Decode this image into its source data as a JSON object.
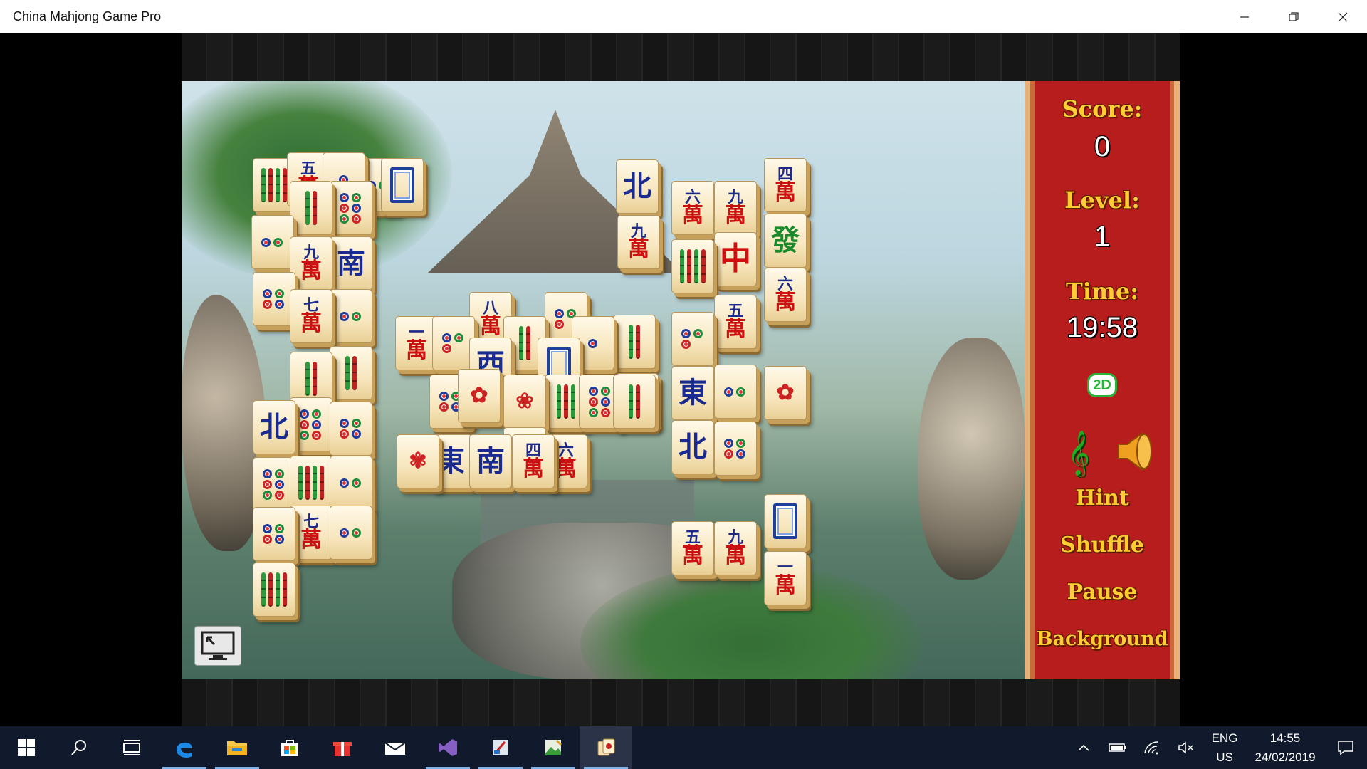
{
  "window": {
    "title": "China Mahjong Game Pro"
  },
  "panel": {
    "score_label": "Score:",
    "score_value": "0",
    "level_label": "Level:",
    "level_value": "1",
    "time_label": "Time:",
    "time_value": "19:58",
    "mode_badge": "2D",
    "hint": "Hint",
    "shuffle": "Shuffle",
    "pause": "Pause",
    "background": "Background"
  },
  "taskbar": {
    "apps": [
      "windows-start",
      "search",
      "task-view",
      "edge",
      "file-explorer",
      "store",
      "gift-app",
      "mail",
      "visual-studio",
      "paint-app",
      "photo-app",
      "mahjong-app"
    ],
    "lang_top": "ENG",
    "lang_bottom": "US",
    "time": "14:55",
    "date": "24/02/2019"
  },
  "tiles": [
    {
      "kind": "bamboo",
      "v": 4
    },
    {
      "kind": "wan",
      "n": "五"
    },
    {
      "kind": "dots",
      "v": 1
    },
    {
      "kind": "dots",
      "v": 2
    },
    {
      "kind": "dots",
      "v": 2
    },
    {
      "kind": "bamboo",
      "v": 2
    },
    {
      "kind": "dots",
      "v": 6
    },
    {
      "kind": "white"
    },
    {
      "kind": "wan",
      "n": "九"
    },
    {
      "kind": "wind",
      "c": "南"
    },
    {
      "kind": "dots",
      "v": 4
    },
    {
      "kind": "wan",
      "n": "七"
    },
    {
      "kind": "dots",
      "v": 2
    },
    {
      "kind": "wind",
      "c": "北"
    },
    {
      "kind": "dots",
      "v": 6
    },
    {
      "kind": "wan",
      "n": "一"
    },
    {
      "kind": "dots",
      "v": 3
    },
    {
      "kind": "wind",
      "c": "西"
    },
    {
      "kind": "bamboo",
      "v": 2
    },
    {
      "kind": "white"
    },
    {
      "kind": "dots",
      "v": 1
    },
    {
      "kind": "bamboo",
      "v": 5
    },
    {
      "kind": "wind",
      "c": "北"
    },
    {
      "kind": "wan",
      "n": "九"
    },
    {
      "kind": "wan",
      "n": "六"
    },
    {
      "kind": "wan",
      "n": "九"
    },
    {
      "kind": "green"
    },
    {
      "kind": "red"
    },
    {
      "kind": "bamboo",
      "v": 5
    },
    {
      "kind": "wan",
      "n": "四"
    },
    {
      "kind": "wan",
      "n": "五"
    },
    {
      "kind": "wan",
      "n": "六"
    },
    {
      "kind": "dots",
      "v": 3
    },
    {
      "kind": "wind",
      "c": "東"
    },
    {
      "kind": "dots",
      "v": 2
    },
    {
      "kind": "flower",
      "c": "✿"
    },
    {
      "kind": "wind",
      "c": "北"
    },
    {
      "kind": "dots",
      "v": 4
    },
    {
      "kind": "flower",
      "c": "❀"
    },
    {
      "kind": "bamboo",
      "v": 3
    },
    {
      "kind": "wind",
      "c": "南"
    },
    {
      "kind": "white"
    },
    {
      "kind": "wan",
      "n": "五"
    },
    {
      "kind": "wan",
      "n": "九"
    },
    {
      "kind": "wan",
      "n": "一"
    },
    {
      "kind": "wind",
      "c": "東"
    },
    {
      "kind": "wind",
      "c": "南"
    },
    {
      "kind": "wan",
      "n": "四"
    },
    {
      "kind": "wan",
      "n": "六"
    },
    {
      "kind": "flower",
      "c": "✾"
    },
    {
      "kind": "flower",
      "c": "✿"
    },
    {
      "kind": "bamboo",
      "v": 2
    },
    {
      "kind": "dots",
      "v": 6
    },
    {
      "kind": "bamboo",
      "v": 4
    },
    {
      "kind": "bamboo",
      "v": 2
    },
    {
      "kind": "dots",
      "v": 4
    },
    {
      "kind": "dots",
      "v": 2
    },
    {
      "kind": "wan",
      "n": "七"
    },
    {
      "kind": "dots",
      "v": 2
    },
    {
      "kind": "dots",
      "v": 4
    },
    {
      "kind": "bamboo",
      "v": 4
    },
    {
      "kind": "dots",
      "v": 6
    },
    {
      "kind": "bamboo",
      "v": 2
    },
    {
      "kind": "dots",
      "v": 4
    },
    {
      "kind": "wan",
      "n": "八"
    },
    {
      "kind": "dots",
      "v": 3
    },
    {
      "kind": "bamboo",
      "v": 2
    },
    {
      "kind": "wan",
      "n": "九"
    }
  ]
}
